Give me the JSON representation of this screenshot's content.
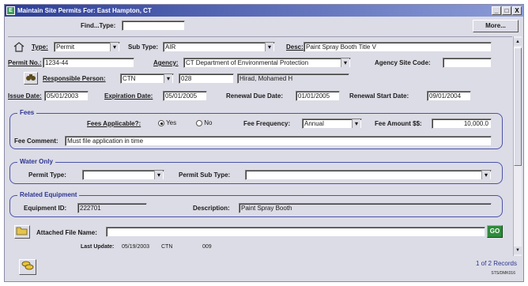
{
  "window": {
    "title": "Maintain Site Permits For: East Hampton, CT",
    "buttons": [
      "_",
      "□",
      "X"
    ]
  },
  "find": {
    "label": "Find...Type:",
    "value": "",
    "more_label": "More..."
  },
  "permit": {
    "type_label": "Type:",
    "type_value": "Permit",
    "subtype_label": "Sub Type:",
    "subtype_value": "AIR",
    "desc_label": "Desc:",
    "desc_value": "Paint Spray Booth Title V",
    "permit_no_label": "Permit No.:",
    "permit_no_value": "1234-44",
    "agency_label": "Agency:",
    "agency_value": "CT Department of Environmental Protection",
    "agency_site_code_label": "Agency Site Code:",
    "agency_site_code_value": "",
    "responsible_label": "Responsible Person:",
    "responsible_code": "CTN",
    "responsible_id": "028",
    "responsible_name": "Hirad, Mohamed H",
    "issue_date_label": "Issue Date:",
    "issue_date_value": "05/01/2003",
    "expiration_label": "Expiration Date:",
    "expiration_value": "05/01/2005",
    "renewal_due_label": "Renewal Due Date:",
    "renewal_due_value": "01/01/2005",
    "renewal_start_label": "Renewal Start Date:",
    "renewal_start_value": "09/01/2004"
  },
  "fees": {
    "group_title": "Fees",
    "applicable_label": "Fees Applicable?:",
    "yes_label": "Yes",
    "no_label": "No",
    "frequency_label": "Fee Frequency:",
    "frequency_value": "Annual",
    "amount_label": "Fee Amount $$:",
    "amount_value": "10,000.0",
    "comment_label": "Fee Comment:",
    "comment_value": "Must file application in time"
  },
  "water": {
    "group_title": "Water Only",
    "permit_type_label": "Permit Type:",
    "permit_type_value": "",
    "permit_sub_type_label": "Permit Sub Type:",
    "permit_sub_type_value": ""
  },
  "equipment": {
    "group_title": "Related Equipment",
    "id_label": "Equipment ID:",
    "id_value": "222701",
    "description_label": "Description:",
    "description_value": "Paint Spray Booth"
  },
  "attachment": {
    "label": "Attached File Name:",
    "value": "",
    "go_label": "GO"
  },
  "last_update": {
    "label": "Last Update:",
    "date": "05/19/2003",
    "user": "CTN",
    "code": "009"
  },
  "footer": {
    "records": "1 of 2 Records",
    "screen_id": "STS/DMK016"
  },
  "colors": {
    "titlebar": "#2c3e98",
    "group_border": "#4a52a8",
    "go_button": "#2e8b3a"
  }
}
